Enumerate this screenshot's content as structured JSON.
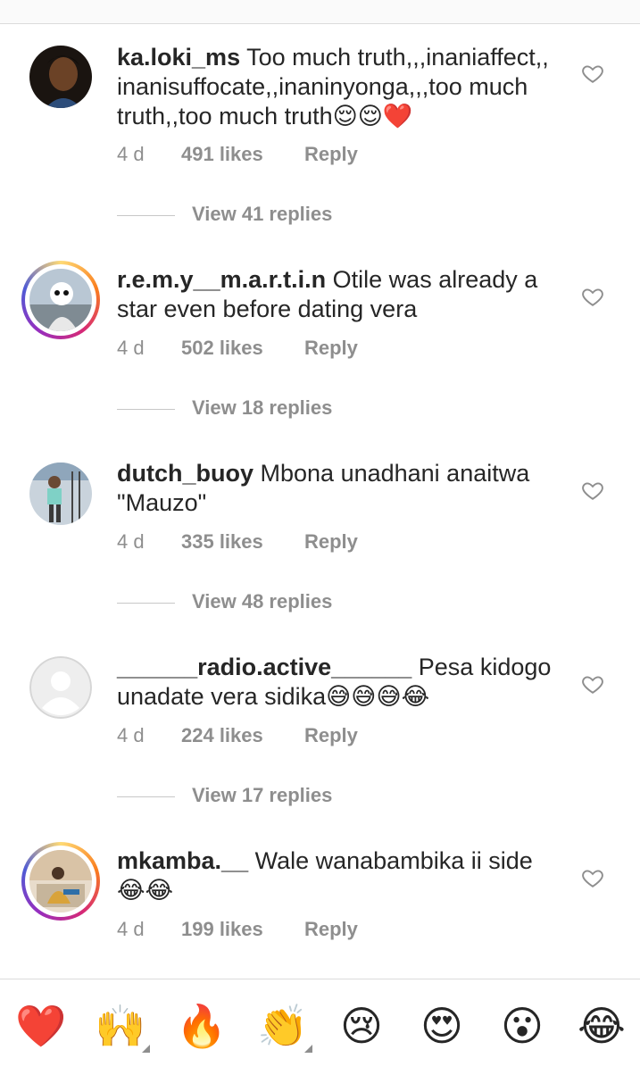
{
  "comments": [
    {
      "username": "ka.loki_ms",
      "body": "Too much truth,,,inaniaffect,, inanisuffocate,,inaninyonga,,,too much truth,,too much truth😌😌❤️",
      "time": "4 d",
      "likes": "491 likes",
      "reply": "Reply",
      "view_replies": "View 41 replies"
    },
    {
      "username": "r.e.m.y__m.a.r.t.i.n",
      "body": "Otile was already a star even before dating vera",
      "time": "4 d",
      "likes": "502 likes",
      "reply": "Reply",
      "view_replies": "View 18 replies"
    },
    {
      "username": "dutch_buoy",
      "body": "Mbona unadhani anaitwa \"Mauzo\"",
      "time": "4 d",
      "likes": "335 likes",
      "reply": "Reply",
      "view_replies": "View 48 replies"
    },
    {
      "username": "______radio.active______",
      "body": "Pesa kidogo unadate vera sidika😅😅😅😂",
      "time": "4 d",
      "likes": "224 likes",
      "reply": "Reply",
      "view_replies": "View 17 replies"
    },
    {
      "username": "mkamba.__",
      "body": "Wale wanabambika ii side 😂😂",
      "time": "4 d",
      "likes": "199 likes",
      "reply": "Reply"
    }
  ],
  "emoji_bar": [
    "❤️",
    "🙌",
    "🔥",
    "👏",
    "😢",
    "😍",
    "😮",
    "😂"
  ],
  "colors": {
    "text": "#262626",
    "secondary": "#8e8e8e",
    "divider": "#dbdbdb",
    "heart_red": "#ed4956"
  }
}
